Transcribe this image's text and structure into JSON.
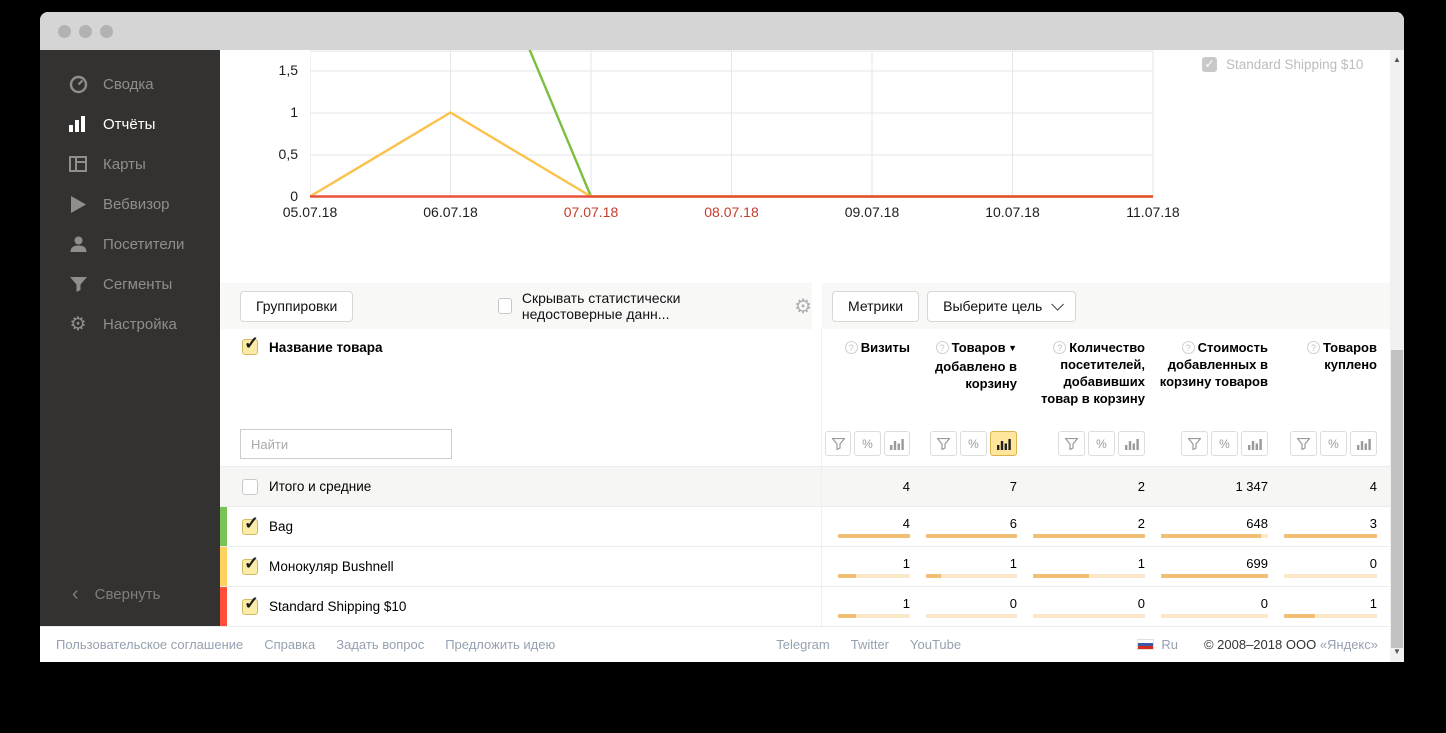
{
  "sidebar": {
    "items": [
      {
        "label": "Сводка",
        "icon": "dashboard",
        "active": false
      },
      {
        "label": "Отчёты",
        "icon": "bar-chart",
        "active": true
      },
      {
        "label": "Карты",
        "icon": "maps",
        "active": false
      },
      {
        "label": "Вебвизор",
        "icon": "play",
        "active": false
      },
      {
        "label": "Посетители",
        "icon": "person",
        "active": false
      },
      {
        "label": "Сегменты",
        "icon": "funnel",
        "active": false
      },
      {
        "label": "Настройка",
        "icon": "gear",
        "active": false
      }
    ],
    "collapse_label": "Свернуть"
  },
  "chart_data": {
    "type": "line",
    "x": [
      "05.07.18",
      "06.07.18",
      "07.07.18",
      "08.07.18",
      "09.07.18",
      "10.07.18",
      "11.07.18"
    ],
    "weekend_dates": [
      "07.07.18",
      "08.07.18"
    ],
    "series": [
      {
        "name": "Bag",
        "color": "#7cbf40",
        "values": [
          2,
          4,
          0,
          0,
          0,
          0,
          0
        ]
      },
      {
        "name": "Монокуляр Bushnell",
        "color": "#fcc14b",
        "values": [
          0,
          1,
          0,
          0,
          0,
          0,
          0
        ]
      },
      {
        "name": "Standard Shipping $10",
        "color": "#e8503a",
        "values": [
          0,
          0,
          0,
          0,
          0,
          0,
          0
        ]
      }
    ],
    "visible_y_ticks": [
      "1,5",
      "1",
      "0,5",
      "0"
    ],
    "ylim_visible": [
      0,
      1.75
    ],
    "grid": true,
    "legend": {
      "visible_item": "Standard Shipping $10",
      "checked": true,
      "position": "top-right"
    }
  },
  "toolbar": {
    "groupings_label": "Группировки",
    "hide_checkbox_label": "Скрывать статистически недостоверные данн...",
    "metrics_label": "Метрики",
    "goal_label": "Выберите цель"
  },
  "table": {
    "name_column_header": "Название товара",
    "search_placeholder": "Найти",
    "columns": [
      {
        "label": "Визиты",
        "sorted": false
      },
      {
        "label": "Товаров добавлено в корзину",
        "sorted": true
      },
      {
        "label": "Количество посетителей, добавивших товар в корзину",
        "sorted": false
      },
      {
        "label": "Стоимость добавленных в корзину товаров",
        "sorted": false
      },
      {
        "label": "Товаров куплено",
        "sorted": false
      }
    ],
    "filter_icons": [
      "filter",
      "percent",
      "bars"
    ],
    "totals_row": {
      "label": "Итого и средние",
      "checked": false,
      "values": [
        "4",
        "7",
        "2",
        "1 347",
        "4"
      ]
    },
    "rows": [
      {
        "label": "Bag",
        "checked": true,
        "color": "#7ac456",
        "values": [
          "4",
          "6",
          "2",
          "648",
          "3"
        ],
        "bar_pcts": [
          100,
          100,
          100,
          93,
          100
        ]
      },
      {
        "label": "Монокуляр Bushnell",
        "checked": true,
        "color": "#ffd25f",
        "values": [
          "1",
          "1",
          "1",
          "699",
          "0"
        ],
        "bar_pcts": [
          25,
          17,
          50,
          100,
          0
        ]
      },
      {
        "label": "Standard Shipping $10",
        "checked": true,
        "color": "#ff4f38",
        "values": [
          "1",
          "0",
          "0",
          "0",
          "1"
        ],
        "bar_pcts": [
          25,
          0,
          0,
          0,
          33
        ]
      }
    ]
  },
  "footer": {
    "links_left": [
      "Пользовательское соглашение",
      "Справка",
      "Задать вопрос",
      "Предложить идею"
    ],
    "links_social": [
      "Telegram",
      "Twitter",
      "YouTube"
    ],
    "lang": "Ru",
    "copyright": "© 2008–2018 ООО",
    "copyright_org": "«Яндекс»"
  }
}
